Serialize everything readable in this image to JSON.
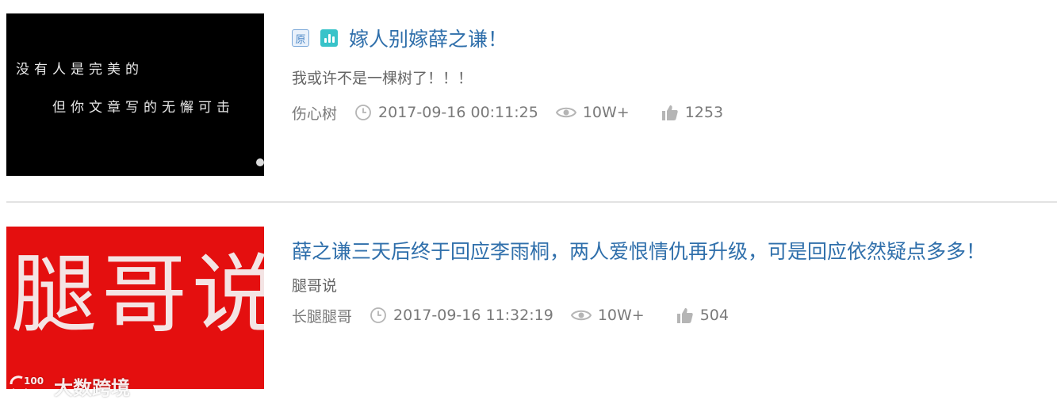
{
  "articles": [
    {
      "thumbnail": {
        "line1": "没有人是完美的",
        "line2": "但你文章写的无懈可击"
      },
      "badges": [
        "原"
      ],
      "title": "嫁人别嫁薛之谦！",
      "summary": "我或许不是一棵树了！！！",
      "author": "伤心树",
      "time": "2017-09-16 00:11:25",
      "views": "10W+",
      "likes": "1253"
    },
    {
      "thumbnail": {
        "text": "腿哥说"
      },
      "title": "薛之谦三天后终于回应李雨桐，两人爱恨情仇再升级，可是回应依然疑点多多！",
      "summary": "腿哥说",
      "author": "长腿腿哥",
      "time": "2017-09-16 11:32:19",
      "views": "10W+",
      "likes": "504"
    }
  ],
  "watermark": {
    "logo_text": "100",
    "text": "大数跨境"
  },
  "icons": {
    "original_badge": "original-badge-icon",
    "video_badge": "video-badge-icon",
    "clock": "clock-icon",
    "views": "eye-icon",
    "likes": "thumbs-up-icon"
  },
  "colors": {
    "title": "#2f6fab",
    "meta": "#7a7a7a",
    "video_badge": "#38c3c9",
    "thumb2_bg": "#e40f0f"
  }
}
